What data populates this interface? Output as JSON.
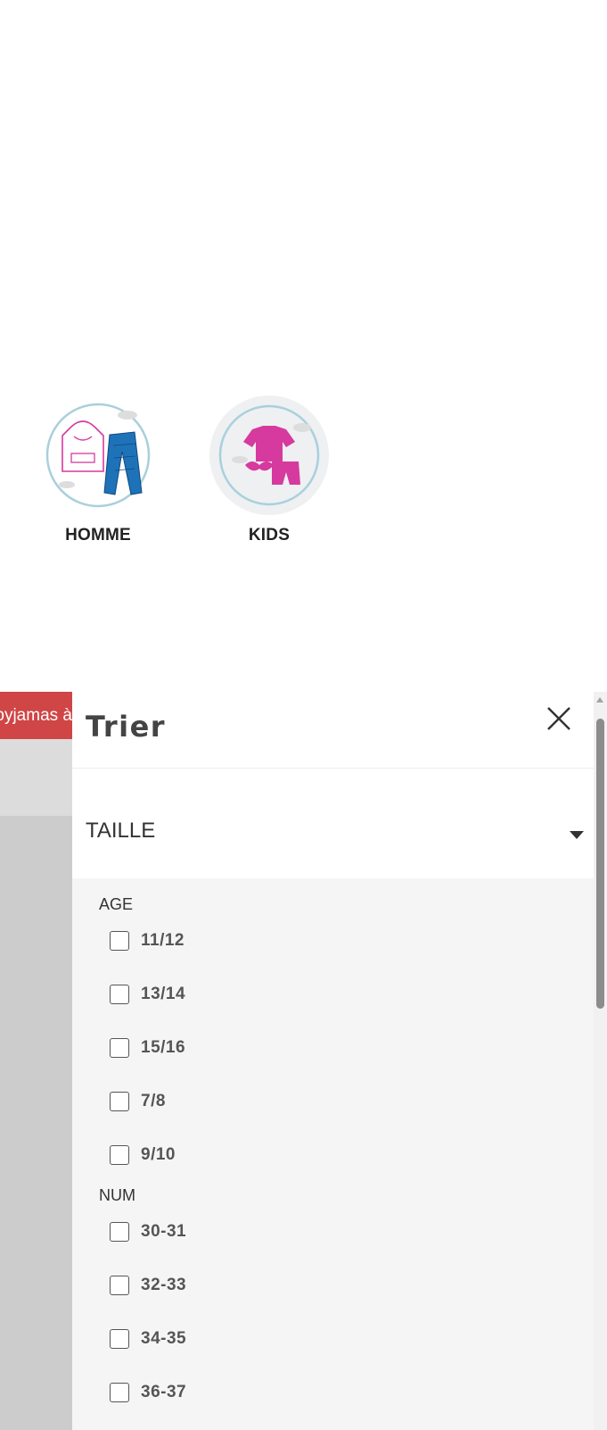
{
  "categories": [
    {
      "label": "HOMME",
      "icon": "men-pajama-icon",
      "active": false
    },
    {
      "label": "KIDS",
      "icon": "kids-pajama-icon",
      "active": true
    }
  ],
  "promo": {
    "text": "pyjamas à"
  },
  "panel": {
    "title": "Trier",
    "close_icon": "close-icon",
    "section": {
      "title": "TAILLE",
      "icon": "caret-down-icon"
    },
    "groups": [
      {
        "label": "AGE",
        "options": [
          "11/12",
          "13/14",
          "15/16",
          "7/8",
          "9/10"
        ]
      },
      {
        "label": "NUM",
        "options": [
          "30-31",
          "32-33",
          "34-35",
          "36-37"
        ]
      }
    ]
  },
  "colors": {
    "pink": "#d63a9e",
    "blue": "#1e72b8",
    "promo_red": "#d04545"
  }
}
